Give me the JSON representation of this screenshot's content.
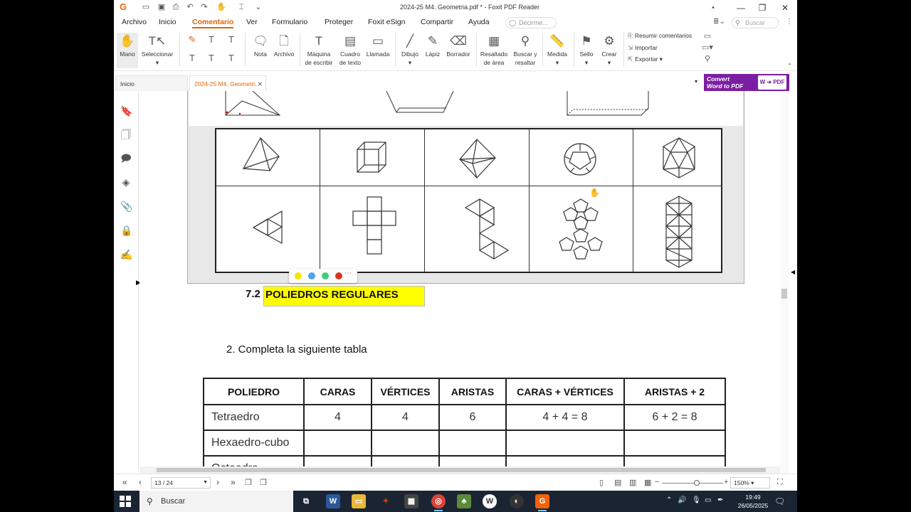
{
  "window": {
    "title": "2024-25 M4. Geometria.pdf * - Foxit PDF Reader"
  },
  "menu": {
    "items": [
      "Archivo",
      "Inicio",
      "Comentario",
      "Ver",
      "Formulario",
      "Proteger",
      "Foxit eSign",
      "Compartir",
      "Ayuda"
    ],
    "active": "Comentario",
    "tell_me": "Decirme...",
    "search": "Buscar"
  },
  "ribbon": {
    "mano": "Mano",
    "seleccionar": "Seleccionar",
    "nota": "Nota",
    "archivo": "Archivo",
    "maquina": [
      "Máquina",
      "de escribir"
    ],
    "cuadro": [
      "Cuadro",
      "de texto"
    ],
    "llamada": "Llamada",
    "dibujo": "Dibujo",
    "lapiz": "Lápiz",
    "borrador": "Borrador",
    "resaltado": [
      "Resaltado",
      "de área"
    ],
    "buscar": [
      "Buscar y",
      "resaltar"
    ],
    "medida": "Medida",
    "sello": "Sello",
    "crear": "Crear",
    "resumir": "Resumir comentarios",
    "importar": "Importar",
    "exportar": "Exportar"
  },
  "tabs": {
    "home": "Inicio",
    "doc": "2024-25 M4. Geometri...",
    "convert": [
      "Convert",
      "Word to PDF"
    ],
    "pdf_label": "PDF"
  },
  "document": {
    "section_number": "7.2",
    "section_title": "POLIEDROS REGULARES",
    "question": "2.   Completa la siguiente tabla",
    "table": {
      "headers": [
        "POLIEDRO",
        "CARAS",
        "VÉRTICES",
        "ARISTAS",
        "CARAS + VÉRTICES",
        "ARISTAS + 2"
      ],
      "rows": [
        [
          "Tetraedro",
          "4",
          "4",
          "6",
          "4 + 4 = 8",
          "6 + 2 = 8"
        ],
        [
          "Hexaedro-cubo",
          "",
          "",
          "",
          "",
          ""
        ],
        [
          "Octaedro",
          "",
          "",
          "",
          "",
          ""
        ]
      ]
    }
  },
  "palette": {
    "colors": [
      "#f5e600",
      "#4aa3f0",
      "#3fcf7a",
      "#d8351b"
    ]
  },
  "status": {
    "page": "13 / 24",
    "zoom": "150%"
  },
  "taskbar": {
    "search": "Buscar",
    "time": "19:49",
    "date": "26/05/2025"
  },
  "colors": {
    "accent": "#e4630a",
    "highlight": "#ffff00",
    "convert_bg": "#7b1fa2"
  }
}
